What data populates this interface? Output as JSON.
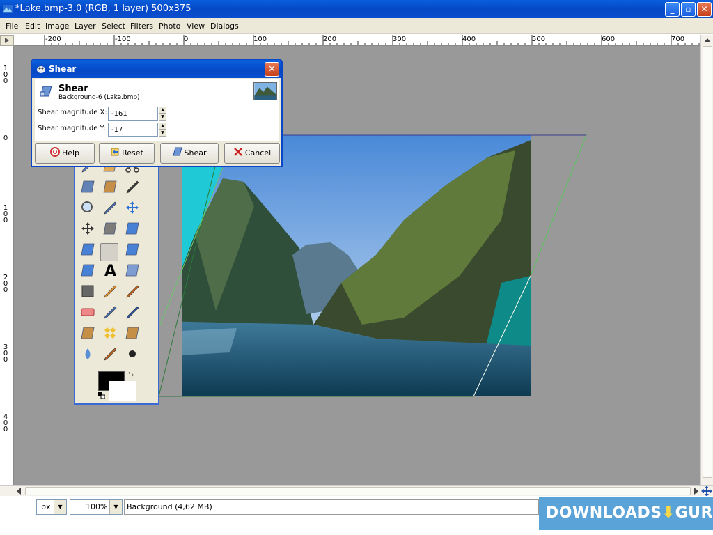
{
  "window": {
    "title": "*Lake.bmp-3.0 (RGB, 1 layer) 500x375",
    "minimize": "_",
    "maximize": "▫",
    "close": "✕"
  },
  "menubar": {
    "items": [
      "File",
      "Edit",
      "Image",
      "Layer",
      "Select",
      "Filters",
      "Photo",
      "View",
      "Dialogs"
    ]
  },
  "rulers": {
    "horizontal_ticks": [
      "-200",
      "-100",
      "0",
      "100",
      "200",
      "300",
      "400",
      "500",
      "600",
      "700"
    ],
    "vertical_ticks": [
      "1 0 0",
      "0",
      "1 0 0",
      "2 0 0",
      "3 0 0",
      "4 0 0"
    ]
  },
  "shear_dialog": {
    "title": "Shear",
    "header_title": "Shear",
    "header_subtitle": "Background-6 (Lake.bmp)",
    "fields": [
      {
        "label": "Shear magnitude X:",
        "value": "-161"
      },
      {
        "label": "Shear magnitude Y:",
        "value": "-17"
      }
    ],
    "buttons": {
      "help": "Help",
      "reset": "Reset",
      "shear": "Shear",
      "cancel": "Cancel"
    }
  },
  "toolbox": {
    "tools": [
      "free-select-icon",
      "fuzzy-select-icon",
      "scissors-icon",
      "foreground-select-icon",
      "paths-icon",
      "color-picker-icon",
      "zoom-icon",
      "measure-icon",
      "move-icon",
      "align-icon",
      "crop-icon",
      "rotate-icon",
      "scale-icon",
      "shear-icon",
      "perspective-icon",
      "flip-icon",
      "text-icon",
      "bucket-fill-icon",
      "blend-icon",
      "pencil-icon",
      "paintbrush-icon",
      "eraser-icon",
      "airbrush-icon",
      "ink-icon",
      "clone-icon",
      "heal-icon",
      "perspective-clone-icon",
      "blur-icon",
      "smudge-icon",
      "dodge-burn-icon"
    ],
    "active_tool": "shear-icon",
    "foreground_color": "#000000",
    "background_color": "#ffffff"
  },
  "statusbar": {
    "unit": "px",
    "zoom": "100%",
    "status": "Background (4,62 MB)"
  },
  "watermark": {
    "text_left": "DOWNLOADS",
    "text_right": "GURU"
  }
}
